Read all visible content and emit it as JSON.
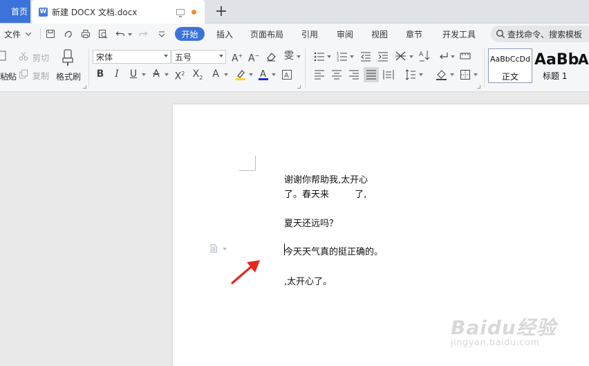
{
  "tabs": {
    "home_label": "首页",
    "doc_title": "新建 DOCX 文档.docx",
    "doc_badge": "W",
    "new_tab": "+"
  },
  "menu": {
    "file_label": "文件",
    "items": [
      "开始",
      "插入",
      "页面布局",
      "引用",
      "审阅",
      "视图",
      "章节",
      "开发工具"
    ],
    "search_text": "查找命令、搜索模板"
  },
  "ribbon": {
    "cut": "剪切",
    "paste": "粘贴",
    "copy": "复制",
    "format_painter": "格式刷",
    "font_name": "宋体",
    "font_size": "五号",
    "style_normal_preview": "AaBbCcDd",
    "style_normal": "正文",
    "style_h1_preview": "AaBb",
    "style_h1": "标题 1",
    "style_h2_preview": "A"
  },
  "document": {
    "lines": [
      "谢谢你帮助我,太开心",
      "了。春天来         了,",
      "夏天还远吗？",
      "今天天气真的挺正确的。",
      ",太开心了。"
    ]
  },
  "watermark": {
    "main": "Baidu经验",
    "sub": "jingyan.baidu.com"
  },
  "colors": {
    "accent": "#3c73db",
    "arrow": "#e8261e",
    "highlight": "#ffd21f",
    "font_color": "#1a2bd6"
  }
}
